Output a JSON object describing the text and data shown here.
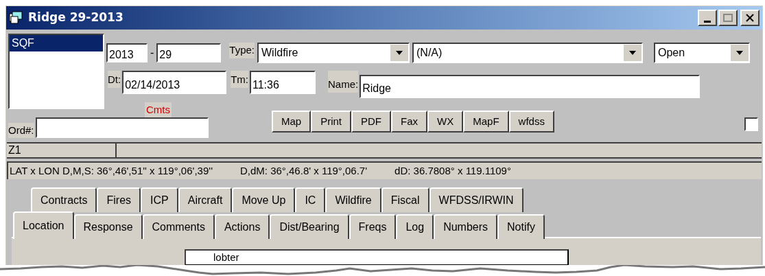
{
  "window": {
    "title": "Ridge 29-2013"
  },
  "list": [
    {
      "label": "SQF",
      "selected": true
    }
  ],
  "year": "2013",
  "separator": "-",
  "number": "29",
  "type": {
    "label": "Type:",
    "value": "Wildfire"
  },
  "subtype": {
    "value": "(N/A)"
  },
  "status": {
    "value": "Open"
  },
  "date": {
    "label": "Dt:",
    "value": "02/14/2013"
  },
  "time": {
    "label": "Tm:",
    "value": "11:36"
  },
  "name": {
    "label": "Name:",
    "value": "Ridge"
  },
  "comments_link": "Cmts",
  "order": {
    "label": "Ord#:"
  },
  "buttons": [
    "Map",
    "Print",
    "PDF",
    "Fax",
    "WX",
    "MapF",
    "wfdss"
  ],
  "checkbox": {
    "checked": false
  },
  "zone": "Z1",
  "coords": [
    "LAT x LON D,M,S: 36°,46',51'' x 119°,06',39''",
    "D,dM: 36°,46.8' x 119°,06.7'",
    "dD: 36.7808° x 119.1109°"
  ],
  "tabs_row1": [
    {
      "label": "Contracts",
      "selected": false
    },
    {
      "label": "Fires",
      "selected": false
    },
    {
      "label": "ICP",
      "selected": false
    },
    {
      "label": "Aircraft",
      "selected": false
    },
    {
      "label": "Move Up",
      "selected": false
    },
    {
      "label": "IC",
      "selected": false
    },
    {
      "label": "Wildfire",
      "selected": false
    },
    {
      "label": "Fiscal",
      "selected": false
    },
    {
      "label": "WFDSS/IRWIN",
      "selected": false
    }
  ],
  "tabs_row2": [
    {
      "label": "Location",
      "selected": true
    },
    {
      "label": "Response",
      "selected": false
    },
    {
      "label": "Comments",
      "selected": false
    },
    {
      "label": "Actions",
      "selected": false
    },
    {
      "label": "Dist/Bearing",
      "selected": false
    },
    {
      "label": "Freqs",
      "selected": false
    },
    {
      "label": "Log",
      "selected": false
    },
    {
      "label": "Numbers",
      "selected": false
    },
    {
      "label": "Notify",
      "selected": false
    }
  ],
  "panel_field": {
    "value": "lobter"
  }
}
